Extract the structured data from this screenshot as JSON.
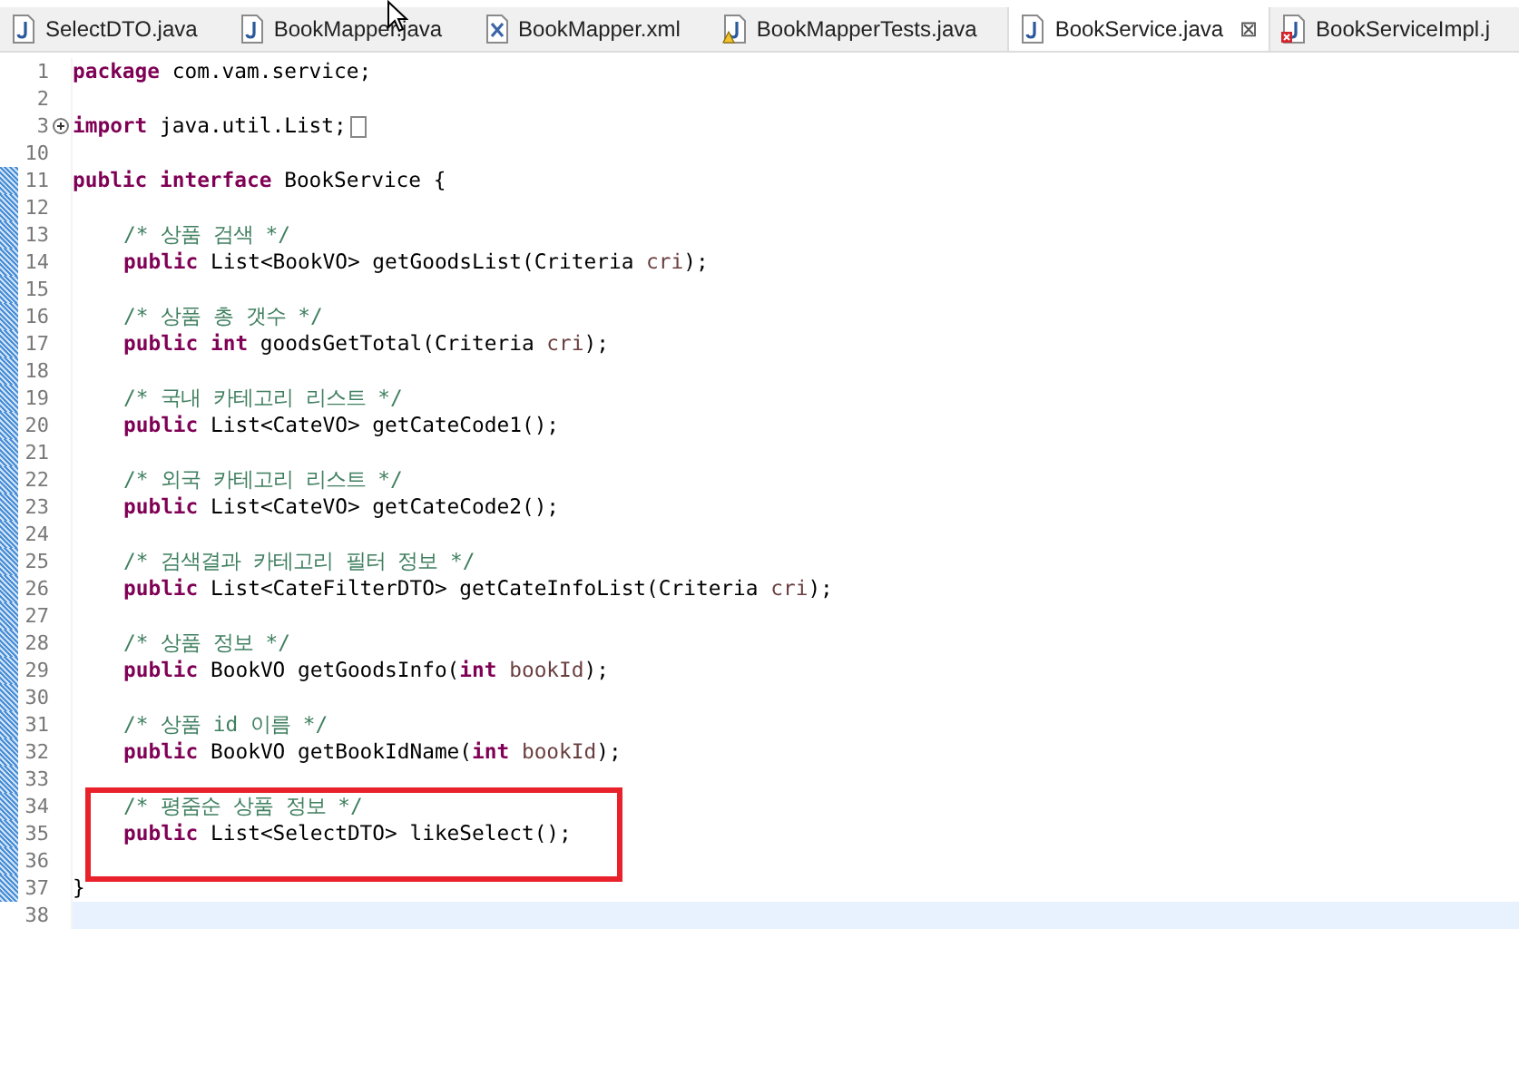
{
  "tabs": [
    {
      "label": "SelectDTO.java",
      "kind": "java",
      "selected": false
    },
    {
      "label": "BookMapper.java",
      "kind": "java",
      "selected": false
    },
    {
      "label": "BookMapper.xml",
      "kind": "xml",
      "selected": false
    },
    {
      "label": "BookMapperTests.java",
      "kind": "java-warning",
      "selected": false
    },
    {
      "label": "BookService.java",
      "kind": "java",
      "selected": true,
      "close": "⊠"
    },
    {
      "label": "BookServiceImpl.j",
      "kind": "java-error",
      "selected": false
    }
  ],
  "lines": [
    {
      "number": "1",
      "tokens": [
        {
          "kind": "keyword",
          "text": "package"
        },
        {
          "kind": "plain",
          "text": " com.vam.service;"
        }
      ]
    },
    {
      "number": "2"
    },
    {
      "number": "3",
      "folded": true,
      "tokens": [
        {
          "kind": "keyword",
          "text": "import"
        },
        {
          "kind": "plain",
          "text": " java.util.List;"
        }
      ]
    },
    {
      "number": "10"
    },
    {
      "number": "11",
      "changed": true,
      "tokens": [
        {
          "kind": "keyword",
          "text": "public interface"
        },
        {
          "kind": "plain",
          "text": " BookService {"
        }
      ]
    },
    {
      "number": "12",
      "changed": true
    },
    {
      "number": "13",
      "indented": true,
      "changed": true,
      "tokens": [
        {
          "kind": "comment",
          "text": "/* 상품 검색 */"
        }
      ]
    },
    {
      "number": "14",
      "indented": true,
      "changed": true,
      "tokens": [
        {
          "kind": "keyword",
          "text": "public"
        },
        {
          "kind": "plain",
          "text": " List<BookVO> getGoodsList(Criteria "
        },
        {
          "kind": "param",
          "text": "cri"
        },
        {
          "kind": "plain",
          "text": ");"
        }
      ]
    },
    {
      "number": "15",
      "changed": true
    },
    {
      "number": "16",
      "indented": true,
      "changed": true,
      "tokens": [
        {
          "kind": "comment",
          "text": "/* 상품 총 갯수 */"
        }
      ]
    },
    {
      "number": "17",
      "indented": true,
      "changed": true,
      "tokens": [
        {
          "kind": "keyword",
          "text": "public int"
        },
        {
          "kind": "plain",
          "text": " goodsGetTotal(Criteria "
        },
        {
          "kind": "param",
          "text": "cri"
        },
        {
          "kind": "plain",
          "text": ");"
        }
      ]
    },
    {
      "number": "18",
      "changed": true
    },
    {
      "number": "19",
      "indented": true,
      "changed": true,
      "tokens": [
        {
          "kind": "comment",
          "text": "/* 국내 카테고리 리스트 */"
        }
      ]
    },
    {
      "number": "20",
      "indented": true,
      "changed": true,
      "tokens": [
        {
          "kind": "keyword",
          "text": "public"
        },
        {
          "kind": "plain",
          "text": " List<CateVO> getCateCode1();"
        }
      ]
    },
    {
      "number": "21",
      "changed": true
    },
    {
      "number": "22",
      "indented": true,
      "changed": true,
      "tokens": [
        {
          "kind": "comment",
          "text": "/* 외국 카테고리 리스트 */"
        }
      ]
    },
    {
      "number": "23",
      "indented": true,
      "changed": true,
      "tokens": [
        {
          "kind": "keyword",
          "text": "public"
        },
        {
          "kind": "plain",
          "text": " List<CateVO> getCateCode2();"
        }
      ]
    },
    {
      "number": "24",
      "changed": true
    },
    {
      "number": "25",
      "indented": true,
      "changed": true,
      "tokens": [
        {
          "kind": "comment",
          "text": "/* 검색결과 카테고리 필터 정보 */"
        }
      ]
    },
    {
      "number": "26",
      "indented": true,
      "changed": true,
      "tokens": [
        {
          "kind": "keyword",
          "text": "public"
        },
        {
          "kind": "plain",
          "text": " List<CateFilterDTO> getCateInfoList(Criteria "
        },
        {
          "kind": "param",
          "text": "cri"
        },
        {
          "kind": "plain",
          "text": ");"
        }
      ]
    },
    {
      "number": "27",
      "changed": true
    },
    {
      "number": "28",
      "indented": true,
      "changed": true,
      "tokens": [
        {
          "kind": "comment",
          "text": "/* 상품 정보 */"
        }
      ]
    },
    {
      "number": "29",
      "indented": true,
      "changed": true,
      "tokens": [
        {
          "kind": "keyword",
          "text": "public"
        },
        {
          "kind": "plain",
          "text": " BookVO getGoodsInfo("
        },
        {
          "kind": "keyword",
          "text": "int"
        },
        {
          "kind": "param",
          "text": " bookId"
        },
        {
          "kind": "plain",
          "text": ");"
        }
      ]
    },
    {
      "number": "30",
      "changed": true
    },
    {
      "number": "31",
      "indented": true,
      "changed": true,
      "tokens": [
        {
          "kind": "comment",
          "text": "/* 상품 id 이름 */"
        }
      ]
    },
    {
      "number": "32",
      "indented": true,
      "changed": true,
      "tokens": [
        {
          "kind": "keyword",
          "text": "public"
        },
        {
          "kind": "plain",
          "text": " BookVO getBookIdName("
        },
        {
          "kind": "keyword",
          "text": "int"
        },
        {
          "kind": "param",
          "text": " bookId"
        },
        {
          "kind": "plain",
          "text": ");"
        }
      ]
    },
    {
      "number": "33",
      "changed": true
    },
    {
      "number": "34",
      "indented": true,
      "changed": true,
      "boxed": true,
      "tokens": [
        {
          "kind": "comment",
          "text": "/* 평줌순 상품 정보 */"
        }
      ]
    },
    {
      "number": "35",
      "indented": true,
      "changed": true,
      "boxed": true,
      "tokens": [
        {
          "kind": "keyword",
          "text": "public"
        },
        {
          "kind": "plain",
          "text": " List<SelectDTO> likeSelect();"
        }
      ]
    },
    {
      "number": "36",
      "changed": true,
      "boxed": true
    },
    {
      "number": "37",
      "changed": true,
      "tokens": [
        {
          "kind": "plain",
          "text": "}"
        }
      ]
    },
    {
      "number": "38",
      "current": true
    }
  ]
}
